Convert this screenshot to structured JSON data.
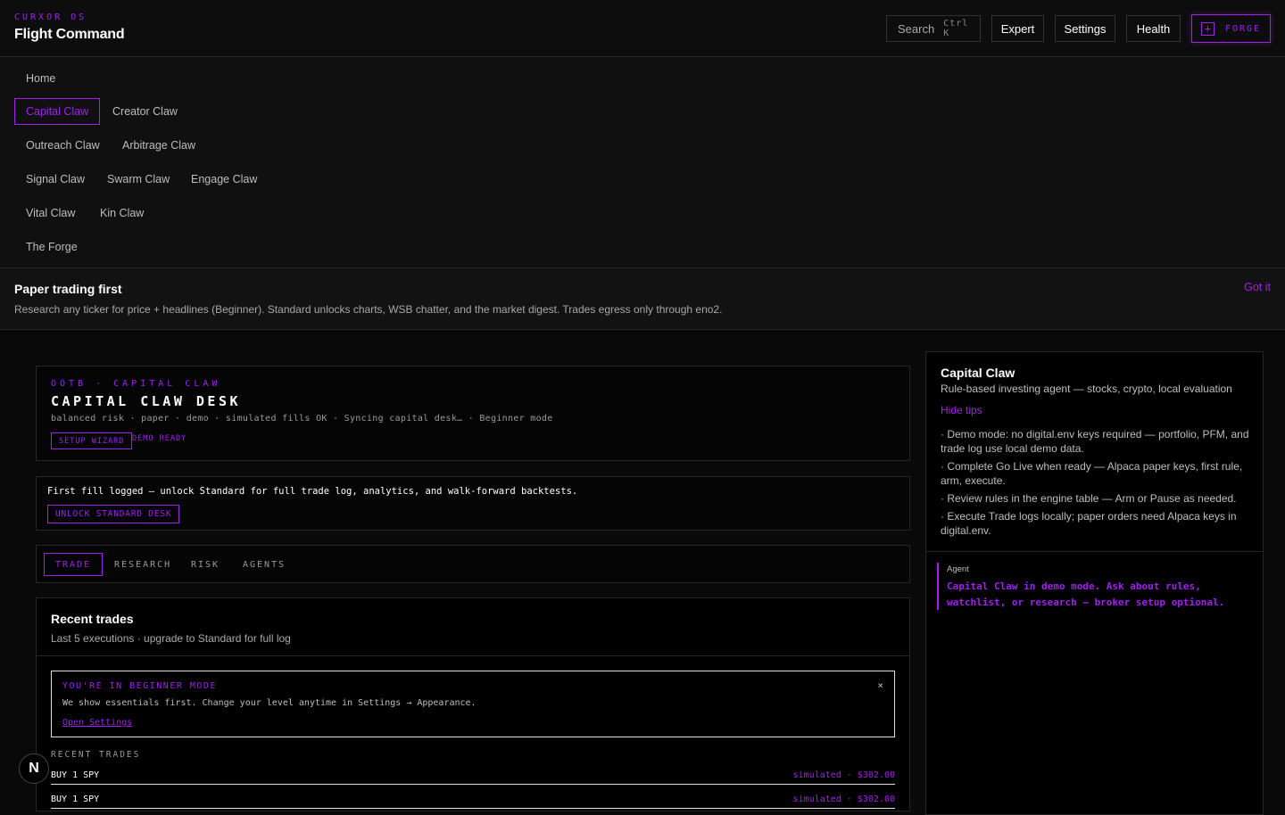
{
  "header": {
    "brand_small": "CURXOR OS",
    "title": "Flight Command",
    "search_label": "Search",
    "search_kbd": "Ctrl K",
    "expert_label": "Expert",
    "settings_label": "Settings",
    "health_label": "Health",
    "forge_label": "FORGE"
  },
  "nav": {
    "items": [
      {
        "label": "Home",
        "active": false
      },
      {
        "label": "Capital Claw",
        "active": true
      },
      {
        "label": "Creator Claw",
        "active": false
      },
      {
        "label": "Outreach Claw",
        "active": false
      },
      {
        "label": "Arbitrage Claw",
        "active": false
      },
      {
        "label": "Signal Claw",
        "active": false
      },
      {
        "label": "Swarm Claw",
        "active": false
      },
      {
        "label": "Engage Claw",
        "active": false
      },
      {
        "label": "Vital Claw",
        "active": false
      },
      {
        "label": "Kin Claw",
        "active": false
      },
      {
        "label": "The Forge",
        "active": false
      }
    ]
  },
  "tip": {
    "title": "Paper trading first",
    "text": "Research any ticker for price + headlines (Beginner). Standard unlocks charts, WSB chatter, and the market digest. Trades egress only through eno2.",
    "dismiss": "Got it"
  },
  "desk": {
    "eyebrow": "OOTB · CAPITAL CLAW",
    "title": "CAPITAL CLAW DESK",
    "meta": "balanced risk · paper · demo · simulated fills OK · Syncing capital desk… · Beginner mode",
    "wizard": "SETUP WIZARD",
    "status": "DEMO READY"
  },
  "unlock": {
    "text": "First fill logged — unlock Standard for full trade log, analytics, and walk-forward backtests.",
    "button": "UNLOCK STANDARD DESK"
  },
  "tabs": [
    {
      "label": "TRADE",
      "active": true
    },
    {
      "label": "RESEARCH",
      "active": false
    },
    {
      "label": "RISK",
      "active": false
    },
    {
      "label": "AGENTS",
      "active": false
    }
  ],
  "trades": {
    "title": "Recent trades",
    "subtitle": "Last 5 executions · upgrade to Standard for full log",
    "beginner": {
      "title": "YOU'RE IN BEGINNER MODE",
      "text": "We show essentials first. Change your level anytime in Settings → Appearance.",
      "link": "Open Settings",
      "close": "×"
    },
    "section_label": "RECENT TRADES",
    "rows": [
      {
        "action": "BUY 1 SPY",
        "detail": "simulated · $302.00"
      },
      {
        "action": "BUY 1 SPY",
        "detail": "simulated · $302.00"
      }
    ]
  },
  "side": {
    "title": "Capital Claw",
    "subtitle": "Rule-based investing agent — stocks, crypto, local evaluation",
    "hide_tips": "Hide tips",
    "tips": [
      "· Demo mode: no digital.env keys required — portfolio, PFM, and trade log use local demo data.",
      "· Complete Go Live when ready — Alpaca paper keys, first rule, arm, execute.",
      "· Review rules in the engine table — Arm or Pause as needed.",
      "· Execute Trade logs locally; paper orders need Alpaca keys in digital.env."
    ],
    "agent_label": "Agent",
    "agent_text": "Capital Claw in demo mode. Ask about rules, watchlist, or research — broker setup optional."
  },
  "badge": {
    "letter": "N"
  },
  "colors": {
    "accent": "#a020f0",
    "background": "#0a0a0a"
  }
}
